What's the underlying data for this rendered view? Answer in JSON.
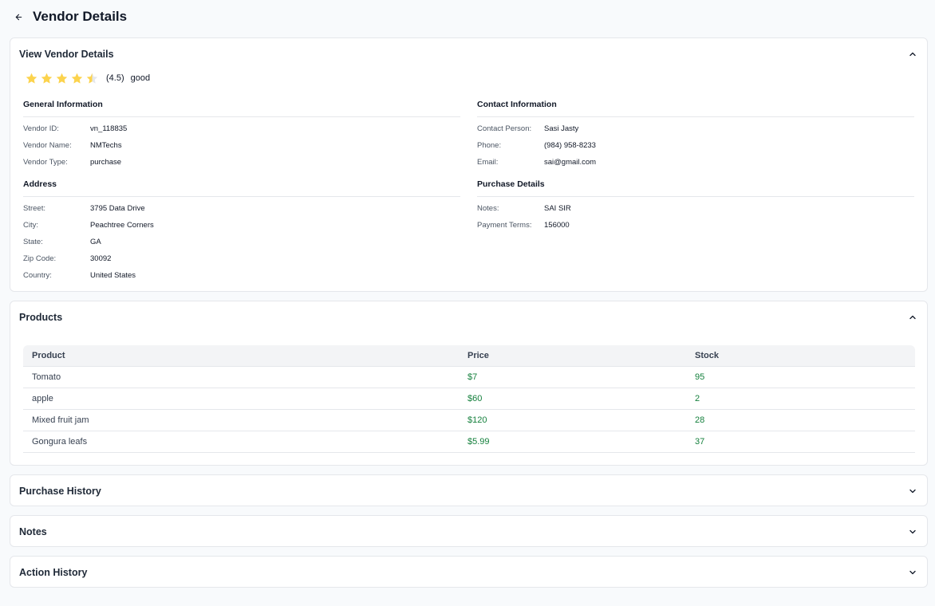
{
  "header": {
    "title": "Vendor Details",
    "back_icon": "arrow-left-icon"
  },
  "vendor_card": {
    "title": "View Vendor Details",
    "rating": {
      "value": 4.5,
      "max": 5,
      "display": "(4.5)",
      "label": "good",
      "star_color": "#fcd34d",
      "star_empty_color": "#e5e7eb"
    },
    "general": {
      "title": "General Information",
      "rows": [
        {
          "label": "Vendor ID:",
          "value": "vn_118835"
        },
        {
          "label": "Vendor Name:",
          "value": "NMTechs"
        },
        {
          "label": "Vendor Type:",
          "value": "purchase"
        }
      ]
    },
    "contact": {
      "title": "Contact Information",
      "rows": [
        {
          "label": "Contact Person:",
          "value": "Sasi Jasty"
        },
        {
          "label": "Phone:",
          "value": "(984) 958-8233"
        },
        {
          "label": "Email:",
          "value": "sai@gmail.com"
        }
      ]
    },
    "address": {
      "title": "Address",
      "rows": [
        {
          "label": "Street:",
          "value": "3795 Data Drive"
        },
        {
          "label": "City:",
          "value": "Peachtree Corners"
        },
        {
          "label": "State:",
          "value": "GA"
        },
        {
          "label": "Zip Code:",
          "value": "30092"
        },
        {
          "label": "Country:",
          "value": "United States"
        }
      ]
    },
    "purchase": {
      "title": "Purchase Details",
      "rows": [
        {
          "label": "Notes:",
          "value": "SAI SIR"
        },
        {
          "label": "Payment Terms:",
          "value": "156000"
        }
      ]
    }
  },
  "products_card": {
    "title": "Products",
    "columns": [
      "Product",
      "Price",
      "Stock"
    ],
    "rows": [
      {
        "product": "Tomato",
        "price": "$7",
        "stock": "95"
      },
      {
        "product": "apple",
        "price": "$60",
        "stock": "2"
      },
      {
        "product": "Mixed fruit jam",
        "price": "$120",
        "stock": "28"
      },
      {
        "product": "Gongura leafs",
        "price": "$5.99",
        "stock": "37"
      }
    ]
  },
  "purchase_history_card": {
    "title": "Purchase History"
  },
  "notes_card": {
    "title": "Notes"
  },
  "action_history_card": {
    "title": "Action History"
  },
  "colors": {
    "accent_green": "#15803d",
    "border": "#e5e7eb",
    "background": "#f8fafc"
  }
}
